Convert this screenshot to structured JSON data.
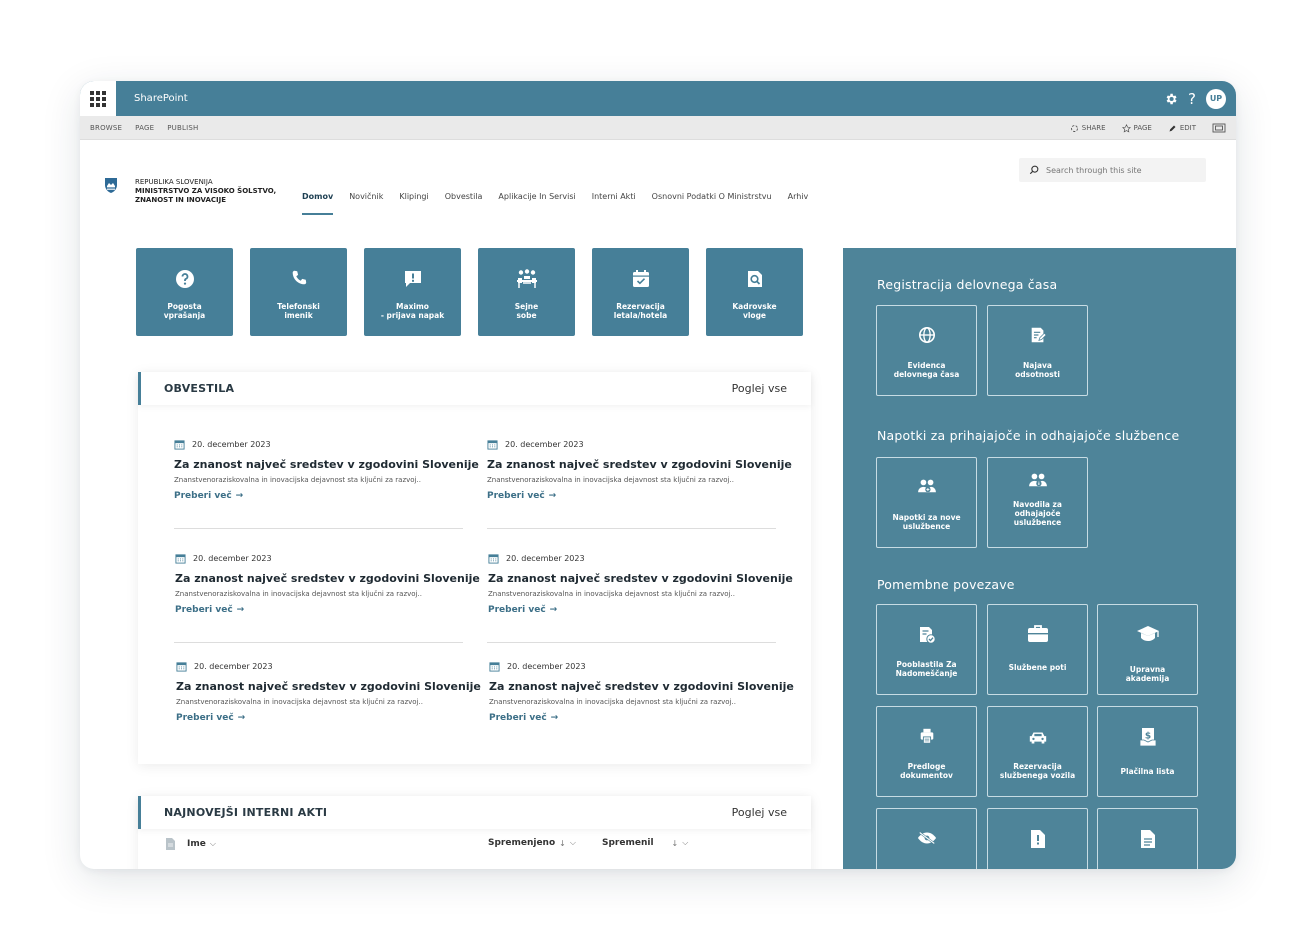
{
  "suite": {
    "brand": "SharePoint",
    "help": "?",
    "avatar": "UP"
  },
  "ribbon": {
    "tabs": [
      "BROWSE",
      "PAGE",
      "PUBLISH"
    ],
    "actions": {
      "share": "SHARE",
      "follow": "PAGE",
      "edit": "EDIT"
    }
  },
  "header": {
    "org_line1": "REPUBLIKA SLOVENIJA",
    "org_line2": "MINISTRSTVO ZA VISOKO ŠOLSTVO,",
    "org_line3": "ZNANOST IN INOVACIJE",
    "nav": [
      "Domov",
      "Novičnik",
      "Klipingi",
      "Obvestila",
      "Aplikacije In Servisi",
      "Interni Akti",
      "Osnovni Podatki O Ministrstvu",
      "Arhiv"
    ],
    "active_nav": "Domov",
    "search_placeholder": "Search through this site"
  },
  "quick_tiles": [
    {
      "icon": "question-circle-icon",
      "l1": "Pogosta",
      "l2": "vprašanja"
    },
    {
      "icon": "phone-icon",
      "l1": "Telefonski",
      "l2": "imenik"
    },
    {
      "icon": "alert-message-icon",
      "l1": "Maximo",
      "l2": "- prijava napak"
    },
    {
      "icon": "meeting-room-icon",
      "l1": "Sejne",
      "l2": "sobe"
    },
    {
      "icon": "calendar-check-icon",
      "l1": "Rezervacija",
      "l2": "letala/hotela"
    },
    {
      "icon": "document-search-icon",
      "l1": "Kadrovske",
      "l2": "vloge"
    }
  ],
  "obvestila": {
    "title": "OBVESTILA",
    "link": "Poglej vse",
    "items": [
      {
        "date": "20. december 2023",
        "title": "Za znanost največ sredstev v zgodovini Slovenije",
        "desc": "Znanstvenoraziskovalna in inovacijska dejavnost sta ključni za razvoj..",
        "more": "Preberi več"
      },
      {
        "date": "20. december 2023",
        "title": "Za znanost največ sredstev v zgodovini Slovenije",
        "desc": "Znanstvenoraziskovalna in inovacijska dejavnost sta ključni za razvoj..",
        "more": "Preberi več"
      },
      {
        "date": "20. december 2023",
        "title": "Za znanost največ sredstev v zgodovini Slovenije",
        "desc": "Znanstvenoraziskovalna in inovacijska dejavnost sta ključni za razvoj..",
        "more": "Preberi več"
      },
      {
        "date": "20. december 2023",
        "title": "Za znanost največ sredstev v zgodovini Slovenije",
        "desc": "Znanstvenoraziskovalna in inovacijska dejavnost sta ključni za razvoj..",
        "more": "Preberi več"
      },
      {
        "date": "20. december 2023",
        "title": "Za znanost največ sredstev v zgodovini Slovenije",
        "desc": "Znanstvenoraziskovalna in inovacijska dejavnost sta ključni za razvoj..",
        "more": "Preberi več"
      },
      {
        "date": "20. december 2023",
        "title": "Za znanost največ sredstev v zgodovini Slovenije",
        "desc": "Znanstvenoraziskovalna in inovacijska dejavnost sta ključni za razvoj..",
        "more": "Preberi več"
      }
    ]
  },
  "interni_akti": {
    "title": "NAJNOVEJŠI INTERNI AKTI",
    "link": "Poglej vse",
    "columns": {
      "name": "Ime",
      "modified": "Spremenjeno",
      "modified_by": "Spremenil"
    }
  },
  "panel": {
    "sections": [
      {
        "title": "Registracija delovnega časa",
        "tiles": [
          {
            "icon": "globe-icon",
            "l1": "Evidenca",
            "l2": "delovnega časa",
            "l3": ""
          },
          {
            "icon": "document-edit-icon",
            "l1": "Najava",
            "l2": "odsotnosti",
            "l3": ""
          }
        ]
      },
      {
        "title": "Napotki za prihajajoče in odhajajoče službence",
        "tiles": [
          {
            "icon": "users-add-icon",
            "l1": "Napotki za nove",
            "l2": "uslužbence",
            "l3": ""
          },
          {
            "icon": "users-info-icon",
            "l1": "Navodila za",
            "l2": "odhajajoče",
            "l3": "uslužbence"
          }
        ]
      },
      {
        "title": "Pomembne povezave",
        "tiles": [
          {
            "icon": "document-check-icon",
            "l1": "Pooblastila Za",
            "l2": "Nadomeščanje",
            "l3": ""
          },
          {
            "icon": "briefcase-icon",
            "l1": "Službene poti",
            "l2": "",
            "l3": ""
          },
          {
            "icon": "graduation-cap-icon",
            "l1": "Upravna",
            "l2": "akademija",
            "l3": ""
          },
          {
            "icon": "printer-icon",
            "l1": "Predloge",
            "l2": "dokumentov",
            "l3": ""
          },
          {
            "icon": "car-icon",
            "l1": "Rezervacija",
            "l2": "službenega vozila",
            "l3": ""
          },
          {
            "icon": "payslip-icon",
            "l1": "Plačilna lista",
            "l2": "",
            "l3": ""
          },
          {
            "icon": "eye-off-icon",
            "l1": "",
            "l2": "",
            "l3": ""
          },
          {
            "icon": "file-alert-icon",
            "l1": "",
            "l2": "",
            "l3": ""
          },
          {
            "icon": "file-text-icon",
            "l1": "",
            "l2": "",
            "l3": ""
          }
        ]
      }
    ]
  },
  "colors": {
    "accent": "#467f98",
    "panel": "#4e8499",
    "link": "#3c6f87"
  }
}
